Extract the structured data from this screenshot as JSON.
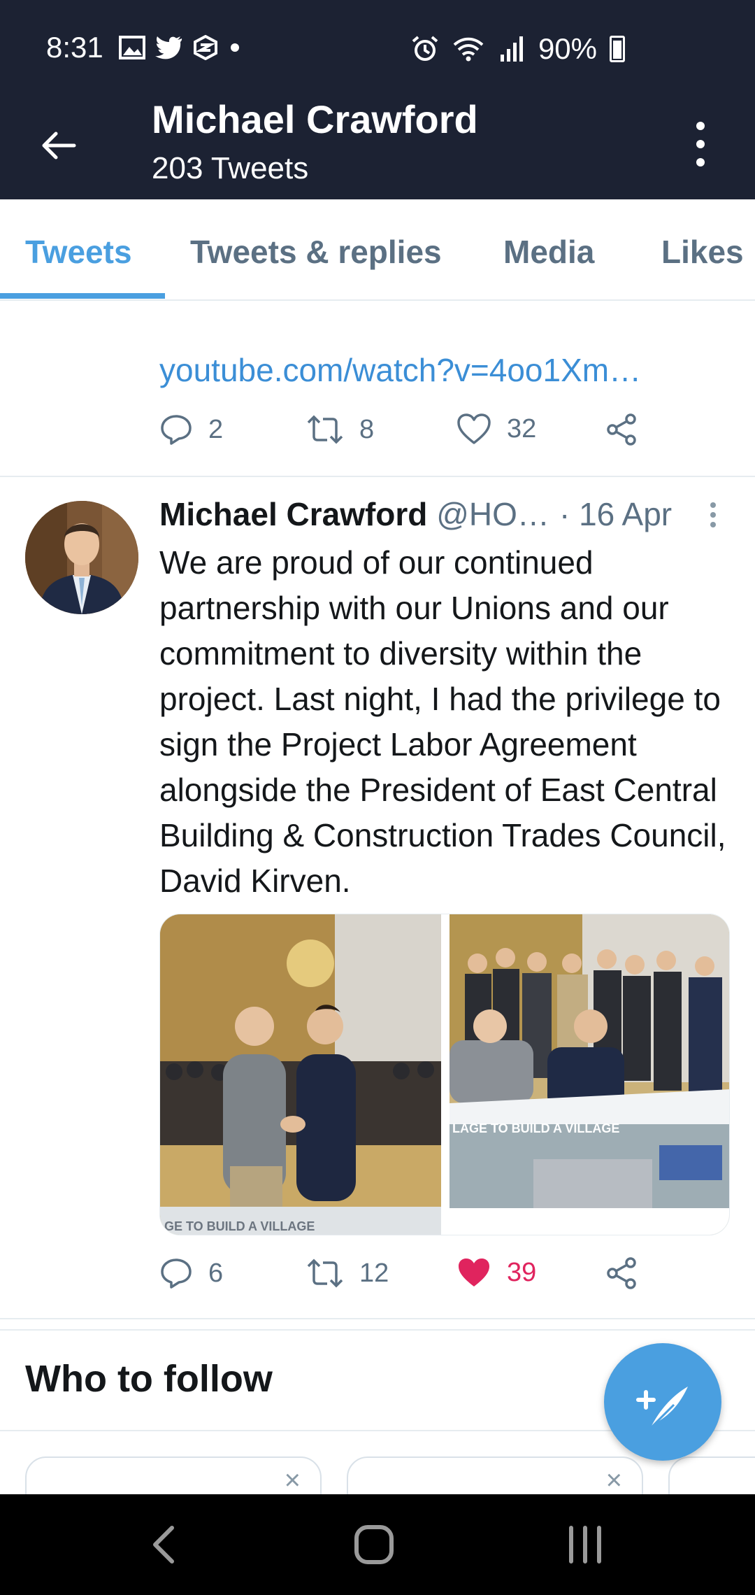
{
  "status_bar": {
    "time": "8:31",
    "battery": "90%"
  },
  "header": {
    "name": "Michael Crawford",
    "tweet_count": "203 Tweets"
  },
  "tabs": [
    {
      "label": "Tweets",
      "active": true
    },
    {
      "label": "Tweets & replies",
      "active": false
    },
    {
      "label": "Media",
      "active": false
    },
    {
      "label": "Likes",
      "active": false
    }
  ],
  "prev_tweet": {
    "link_text": "youtube.com/watch?v=4oo1Xm…",
    "replies": "2",
    "retweets": "8",
    "likes": "32"
  },
  "tweet": {
    "author_name": "Michael Crawford",
    "handle": "@HO…",
    "date": "· 16 Apr",
    "text": "We are proud of our continued partnership with our Unions and our commitment to diversity within the project. Last night, I had the privilege to sign the Project Labor Agreement alongside the President of East Central Building & Construction Trades Council, David Kirven.",
    "banner_left": "GE TO BUILD A VILLAGE",
    "banner_right": "LAGE TO BUILD A VILLAGE",
    "replies": "6",
    "retweets": "12",
    "likes": "39",
    "liked": true
  },
  "who_to_follow": {
    "title": "Who to follow",
    "dismiss": "×"
  },
  "colors": {
    "header_bg": "#1c2233",
    "accent": "#4a9fe0",
    "like_active": "#e0245e"
  }
}
